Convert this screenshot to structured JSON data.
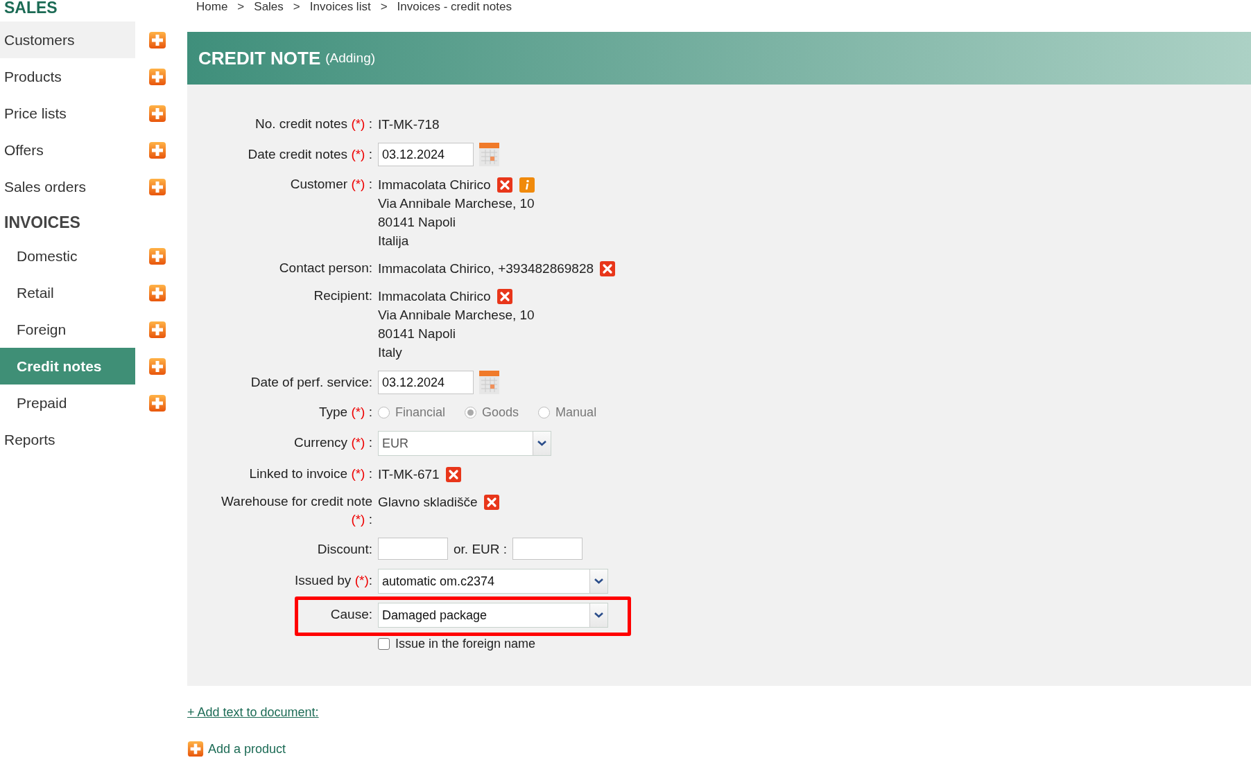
{
  "breadcrumb": [
    {
      "label": "Home"
    },
    {
      "label": "Sales"
    },
    {
      "label": "Invoices list"
    },
    {
      "label": "Invoices - credit notes"
    }
  ],
  "breadcrumb_separator": ">",
  "sidebar": {
    "items": [
      {
        "kind": "heading",
        "label": "SALES"
      },
      {
        "kind": "link",
        "label": "Customers",
        "selected": false,
        "hovered": true,
        "add_button": true
      },
      {
        "kind": "link",
        "label": "Products",
        "selected": false,
        "hovered": false,
        "add_button": true
      },
      {
        "kind": "link",
        "label": "Price lists",
        "selected": false,
        "hovered": false,
        "add_button": true
      },
      {
        "kind": "link",
        "label": "Offers",
        "selected": false,
        "hovered": false,
        "add_button": true
      },
      {
        "kind": "link",
        "label": "Sales orders",
        "selected": false,
        "hovered": false,
        "add_button": true
      },
      {
        "kind": "heading",
        "label": "INVOICES",
        "children": [
          {
            "kind": "link",
            "label": "Domestic",
            "selected": false,
            "hovered": false,
            "add_button": true
          },
          {
            "kind": "link",
            "label": "Retail",
            "selected": false,
            "hovered": false,
            "add_button": true
          },
          {
            "kind": "link",
            "label": "Foreign",
            "selected": false,
            "hovered": false,
            "add_button": true
          },
          {
            "kind": "link",
            "label": "Credit notes",
            "selected": true,
            "hovered": false,
            "add_button": true
          },
          {
            "kind": "link",
            "label": "Prepaid",
            "selected": false,
            "hovered": false,
            "add_button": true
          }
        ]
      },
      {
        "kind": "link",
        "label": "Reports",
        "selected": false,
        "hovered": false,
        "add_button": false
      }
    ]
  },
  "header": {
    "title": "CREDIT NOTE",
    "subtitle": "(Adding)"
  },
  "form": {
    "rows": [
      {
        "kind": "text",
        "label": "No. credit notes",
        "required_mark": "(*)",
        "suffix": " :",
        "lines": [
          "IT-MK-718"
        ]
      },
      {
        "kind": "date",
        "label": "Date credit notes",
        "required_mark": "(*)",
        "suffix": " :",
        "value": "03.12.2024"
      },
      {
        "kind": "text",
        "label": "Customer",
        "required_mark": "(*)",
        "suffix": " :",
        "lines": [
          "Immacolata Chirico",
          "Via Annibale Marchese, 10",
          "80141 Napoli",
          "Italija"
        ],
        "remove": true,
        "info": true
      },
      {
        "kind": "text",
        "label": "Contact person:",
        "lines": [
          "Immacolata Chirico, +393482869828"
        ],
        "remove": true
      },
      {
        "kind": "text",
        "label": "Recipient:",
        "lines": [
          "Immacolata Chirico",
          "Via Annibale Marchese, 10",
          "80141 Napoli",
          "Italy"
        ],
        "remove": true
      },
      {
        "kind": "date",
        "label": "Date of perf. service:",
        "value": "03.12.2024"
      },
      {
        "kind": "radio",
        "label": "Type",
        "required_mark": "(*)",
        "suffix": " :",
        "disabled": true,
        "options": [
          {
            "label": "Financial",
            "selected": false
          },
          {
            "label": "Goods",
            "selected": true
          },
          {
            "label": "Manual",
            "selected": false
          }
        ]
      },
      {
        "kind": "select",
        "label": "Currency",
        "required_mark": "(*)",
        "suffix": " :",
        "value": "EUR",
        "disabled": true,
        "wide": false
      },
      {
        "kind": "text",
        "label": "Linked to invoice",
        "required_mark": "(*)",
        "suffix": " :",
        "lines": [
          "IT-MK-671"
        ],
        "remove": true
      },
      {
        "kind": "text",
        "label": "Warehouse for credit note",
        "required_mark": "(*)",
        "suffix": " :",
        "lines": [
          "Glavno skladišče"
        ],
        "remove": true
      },
      {
        "kind": "discount",
        "label": "Discount:",
        "between": "or. EUR :"
      },
      {
        "kind": "select",
        "label": "Issued by",
        "required_mark": "(*)",
        "suffix": ":",
        "value": "automatic om.c2374",
        "disabled": false,
        "wide": true
      },
      {
        "kind": "select",
        "label": "Cause:",
        "value": "Damaged package",
        "disabled": false,
        "wide": true,
        "highlighted": true
      },
      {
        "kind": "checkbox",
        "text": "Issue in the foreign name",
        "checked": false
      }
    ]
  },
  "links": {
    "add_text": "+ Add text to document:",
    "add_product": "Add a product"
  }
}
